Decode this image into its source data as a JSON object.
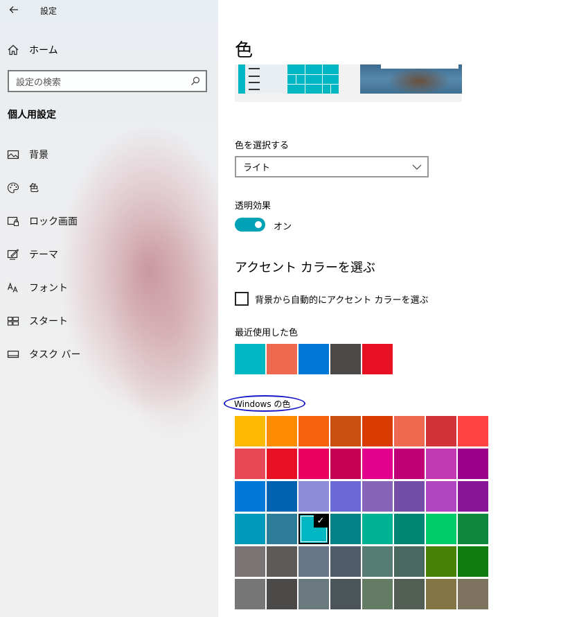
{
  "window": {
    "title": "設定",
    "back_icon": "back-arrow-icon"
  },
  "sidebar": {
    "home_label": "ホーム",
    "search_placeholder": "設定の検索",
    "section_title": "個人用設定",
    "items": [
      {
        "label": "背景",
        "icon": "picture-icon"
      },
      {
        "label": "色",
        "icon": "palette-icon"
      },
      {
        "label": "ロック画面",
        "icon": "lock-screen-icon"
      },
      {
        "label": "テーマ",
        "icon": "theme-icon"
      },
      {
        "label": "フォント",
        "icon": "font-icon"
      },
      {
        "label": "スタート",
        "icon": "start-icon"
      },
      {
        "label": "タスク バー",
        "icon": "taskbar-icon"
      }
    ]
  },
  "main": {
    "title": "色",
    "choose_color_label": "色を選択する",
    "choose_color_value": "ライト",
    "transparency_label": "透明効果",
    "transparency_state": "オン",
    "transparency_on": true,
    "accent_heading": "アクセント カラーを選ぶ",
    "auto_accent_label": "背景から自動的にアクセント カラーを選ぶ",
    "auto_accent_checked": false,
    "recent_label": "最近使用した色",
    "recent_colors": [
      "#00b7c3",
      "#ef6950",
      "#0078d7",
      "#4c4a48",
      "#e81123"
    ],
    "windows_colors_label": "Windows の色",
    "selected_color": "#00b7c3",
    "windows_colors": [
      [
        "#ffb900",
        "#ff8c00",
        "#f7630c",
        "#ca5010",
        "#da3b01",
        "#ef6950",
        "#d13438",
        "#ff4343"
      ],
      [
        "#e74856",
        "#e81123",
        "#ea005e",
        "#c30052",
        "#e3008c",
        "#bf0077",
        "#c239b3",
        "#9a0089"
      ],
      [
        "#0078d7",
        "#0063b1",
        "#8e8cd8",
        "#6b69d6",
        "#8764b8",
        "#744da9",
        "#b146c2",
        "#881798"
      ],
      [
        "#0099bc",
        "#2d7d9a",
        "#00b7c3",
        "#038387",
        "#00b294",
        "#018574",
        "#00cc6a",
        "#10893e"
      ],
      [
        "#7a7574",
        "#5d5a58",
        "#68768a",
        "#515c6b",
        "#567c73",
        "#486860",
        "#498205",
        "#107c10"
      ],
      [
        "#767676",
        "#4c4a48",
        "#69797e",
        "#4a5459",
        "#647c64",
        "#525e54",
        "#847545",
        "#7e735f"
      ]
    ]
  }
}
